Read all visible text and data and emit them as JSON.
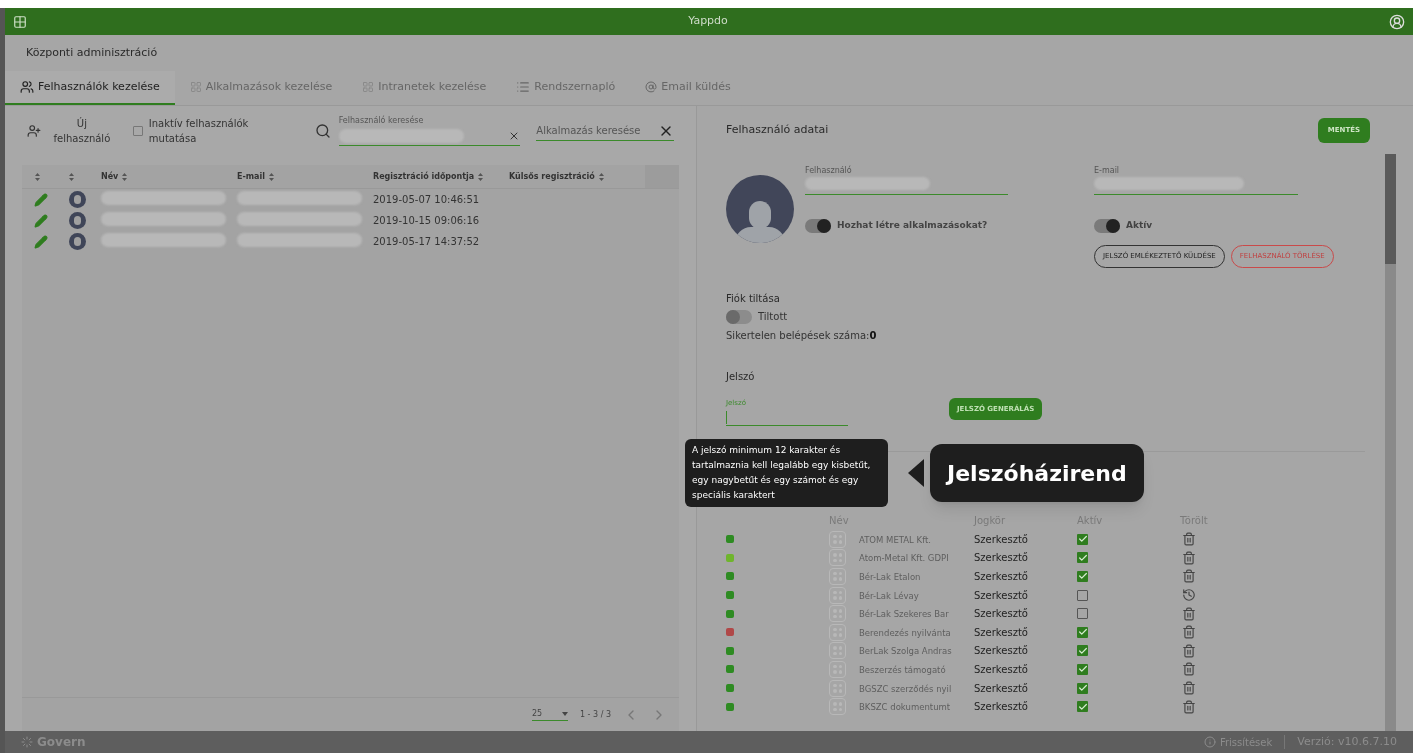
{
  "app_bar": {
    "title": "Yappdo"
  },
  "page_title": "Központi adminisztráció",
  "tabs": [
    {
      "label": "Felhasználók kezelése",
      "kind": "users",
      "selected": true
    },
    {
      "label": "Alkalmazások kezelése",
      "kind": "grid",
      "selected": false
    },
    {
      "label": "Intranetek kezelése",
      "kind": "grid",
      "selected": false
    },
    {
      "label": "Rendszernapló",
      "kind": "list",
      "selected": false
    },
    {
      "label": "Email küldés",
      "kind": "at",
      "selected": false
    }
  ],
  "toolbar": {
    "new_user": "Új felhasználó",
    "show_inactive": {
      "label": "Inaktív felhasználók mutatása",
      "checked": false
    },
    "user_search": {
      "label": "Felhasználó keresése"
    },
    "app_search": {
      "placeholder": "Alkalmazás keresése"
    }
  },
  "users_table": {
    "columns": [
      "Név",
      "E-mail",
      "Regisztráció időpontja",
      "Külsős regisztráció"
    ],
    "rows": [
      {
        "registered": "2019-05-07 10:46:51"
      },
      {
        "registered": "2019-10-15 09:06:16"
      },
      {
        "registered": "2019-05-17 14:37:52"
      }
    ],
    "pagination": {
      "page_size": "25",
      "range": "1 - 3 / 3"
    }
  },
  "user_details": {
    "title": "Felhasználó adatai",
    "save": "MENTÉS",
    "username_label": "Felhasználó",
    "email_label": "E-mail",
    "can_create_apps": {
      "label": "Hozhat létre alkalmazásokat?",
      "on": true
    },
    "active": {
      "label": "Aktív",
      "on": true
    },
    "send_reminder": "JELSZÓ EMLÉKEZTETŐ KÜLDÉSE",
    "delete_user": "FELHASZNÁLÓ TÖRLÉSE",
    "ban_title": "Fiók tiltása",
    "banned": {
      "label": "Tiltott",
      "on": false
    },
    "failed_logins_label": "Sikertelen belépések száma:",
    "failed_logins": "0",
    "password_title": "Jelszó",
    "password_label": "Jelszó",
    "generate": "JELSZÓ GENERÁLÁS",
    "apps_columns": [
      "Név",
      "Jogkör",
      "Aktív",
      "Törölt"
    ],
    "apps": [
      {
        "color": "#2e8b22",
        "name": "ATOM METAL Kft.",
        "role": "Szerkesztő",
        "active": true,
        "kind": "trash"
      },
      {
        "color": "#6fb52c",
        "name": "Atom-Metal Kft. GDPI",
        "role": "Szerkesztő",
        "active": true,
        "kind": "trash"
      },
      {
        "color": "#2e8b22",
        "name": "Bér-Lak Etalon",
        "role": "Szerkesztő",
        "active": true,
        "kind": "trash"
      },
      {
        "color": "#2e8b22",
        "name": "Bér-Lak Lévay",
        "role": "Szerkesztő",
        "active": false,
        "kind": "restore"
      },
      {
        "color": "#2e8b22",
        "name": "Bér-Lak Szekeres Bar",
        "role": "Szerkesztő",
        "active": false,
        "kind": "trash"
      },
      {
        "color": "#b04848",
        "name": "Berendezés nyilvánta",
        "role": "Szerkesztő",
        "active": true,
        "kind": "trash"
      },
      {
        "color": "#2e8b22",
        "name": "BerLak Szolga Andras",
        "role": "Szerkesztő",
        "active": true,
        "kind": "trash"
      },
      {
        "color": "#2e8b22",
        "name": "Beszerzés támogató",
        "role": "Szerkesztő",
        "active": true,
        "kind": "trash"
      },
      {
        "color": "#2e8b22",
        "name": "BGSZC szerződés nyil",
        "role": "Szerkesztő",
        "active": true,
        "kind": "trash"
      },
      {
        "color": "#2e8b22",
        "name": "BKSZC dokumentumt",
        "role": "Szerkesztő",
        "active": true,
        "kind": "trash"
      }
    ]
  },
  "tour": {
    "hint": "A jelszó minimum 12 karakter és tartalmaznia kell legalább egy kisbetűt, egy nagybetűt és egy számot és egy speciális karaktert",
    "title": "Jelszóházirend"
  },
  "footer": {
    "logo": "Govern",
    "updates": "Frissítések",
    "version": "Verzió: v10.6.7.10"
  }
}
